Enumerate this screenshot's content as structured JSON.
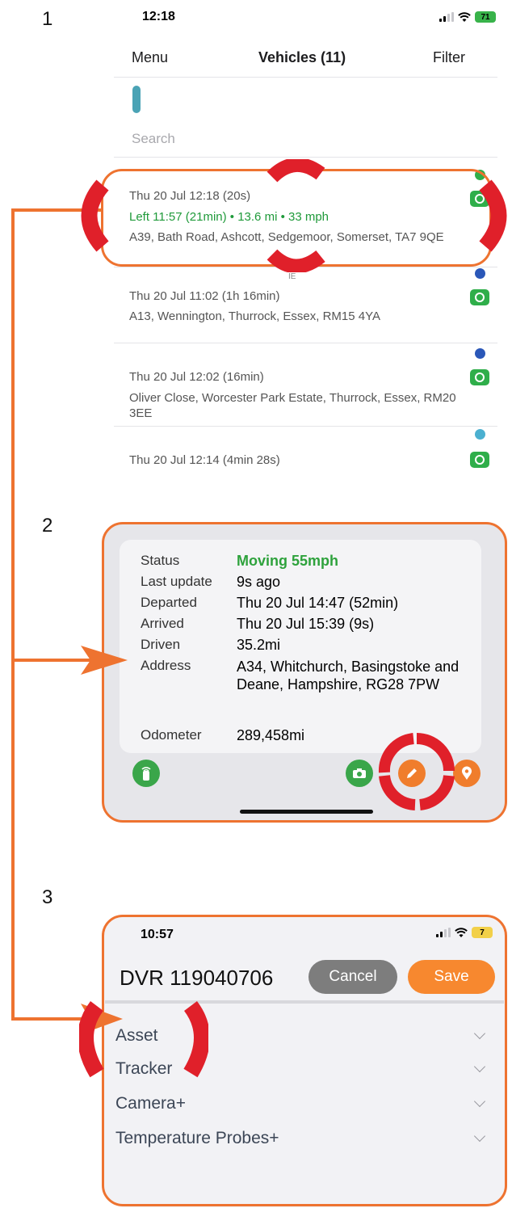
{
  "steps": {
    "one": "1",
    "two": "2",
    "three": "3"
  },
  "panel1": {
    "status_time": "12:18",
    "battery": "71",
    "nav": {
      "menu": "Menu",
      "title": "Vehicles (11)",
      "filter": "Filter"
    },
    "search_placeholder": "Search",
    "hidden_marker": "IE",
    "vehicles": [
      {
        "date": "Thu 20 Jul 12:18 (20s)",
        "left": "Left 11:57 (21min) • 13.6 mi • 33 mph",
        "address": "A39, Bath Road, Ashcott, Sedgemoor, Somerset, TA7 9QE",
        "dot_color": "#2fae4a"
      },
      {
        "date": "Thu 20 Jul 11:02 (1h 16min)",
        "address": "A13, Wennington, Thurrock, Essex, RM15 4YA",
        "dot_color": "#2a57b8"
      },
      {
        "date": "Thu 20 Jul 12:02 (16min)",
        "address": "Oliver Close, Worcester Park Estate, Thurrock, Essex, RM20 3EE",
        "dot_color": "#2a57b8"
      },
      {
        "date": "Thu 20 Jul 12:14 (4min 28s)",
        "address": "",
        "dot_color": "#4bb0d0"
      }
    ]
  },
  "panel2": {
    "labels": {
      "status": "Status",
      "last_update": "Last update",
      "departed": "Departed",
      "arrived": "Arrived",
      "driven": "Driven",
      "address": "Address",
      "odometer": "Odometer"
    },
    "values": {
      "status": "Moving 55mph",
      "last_update": "9s ago",
      "departed": "Thu 20 Jul 14:47 (52min)",
      "arrived": "Thu 20 Jul 15:39 (9s)",
      "driven": "35.2mi",
      "address": "A34, Whitchurch, Basingstoke and Deane, Hampshire, RG28 7PW",
      "odometer": "289,458mi"
    }
  },
  "panel3": {
    "status_time": "10:57",
    "battery": "7",
    "title": "DVR 119040706",
    "cancel_label": "Cancel",
    "save_label": "Save",
    "sections": [
      "Asset",
      "Tracker",
      "Camera+",
      "Temperature Probes+"
    ]
  },
  "colors": {
    "annotation_orange": "#ee7330",
    "highlight_red": "#e0202a",
    "save_orange": "#f7882f",
    "cancel_gray": "#7d7d7d"
  }
}
